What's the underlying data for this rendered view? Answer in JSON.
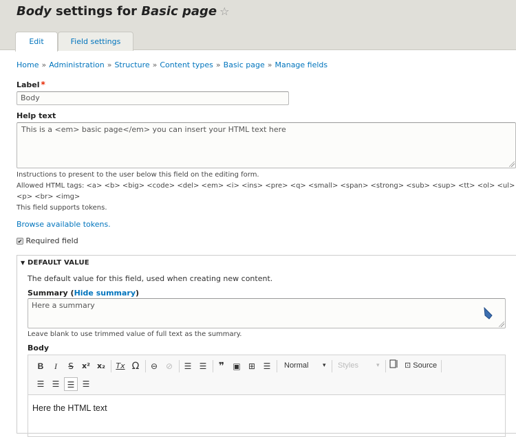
{
  "header": {
    "title_prefix": "Body",
    "title_middle": " settings for ",
    "title_suffix": "Basic page",
    "star_icon": "☆"
  },
  "tabs": [
    {
      "label": "Edit",
      "active": true
    },
    {
      "label": "Field settings",
      "active": false
    }
  ],
  "breadcrumb": [
    {
      "label": "Home"
    },
    {
      "label": "Administration"
    },
    {
      "label": "Structure"
    },
    {
      "label": "Content types"
    },
    {
      "label": "Basic page"
    },
    {
      "label": "Manage fields"
    }
  ],
  "breadcrumb_separator": "»",
  "form": {
    "label_field": {
      "label": "Label",
      "required_mark": "*",
      "value": "Body"
    },
    "help_text": {
      "label": "Help text",
      "value": "This is a <em> basic page</em> you can insert your HTML text here",
      "desc_1": "Instructions to present to the user below this field on the editing form.",
      "desc_2": "Allowed HTML tags: <a> <b> <big> <code> <del> <em> <i> <ins> <pre> <q> <small> <span> <strong> <sub> <sup> <tt> <ol> <ul> <li>",
      "desc_3": "<p> <br> <img>",
      "desc_4": "This field supports tokens."
    },
    "browse_tokens": "Browse available tokens.",
    "required_field": {
      "label": "Required field",
      "checked": true,
      "check_glyph": "✔"
    },
    "default_value": {
      "legend_icon": "▼",
      "legend": "DEFAULT VALUE",
      "description": "The default value for this field, used when creating new content.",
      "summary_label": "Summary (",
      "hide_summary": "Hide summary",
      "summary_close": ")",
      "summary_value": "Here a summary",
      "summary_desc": "Leave blank to use trimmed value of full text as the summary.",
      "body_label": "Body",
      "body_value": "Here the HTML text"
    }
  },
  "editor": {
    "buttons": {
      "bold": "B",
      "italic": "I",
      "strike": "S",
      "superscript": "x²",
      "subscript": "x₂",
      "remove_format": "Tx",
      "special_char": "Ω",
      "link": "⊖",
      "unlink": "⊘",
      "bulleted_list": "☰",
      "numbered_list": "☰",
      "blockquote": "❞",
      "image": "▣",
      "table": "⊞",
      "hr": "☰",
      "align_right": "☰",
      "align_center": "☰",
      "align_left": "☰",
      "justify": "☰",
      "source_icon": "⊡"
    },
    "format_select": "Normal",
    "styles_select": "Styles",
    "source_label": "Source",
    "dropdown_arrow": "▾"
  },
  "colors": {
    "link": "#0074bd",
    "header_bg": "#e0dfd9",
    "required": "#e62600"
  }
}
